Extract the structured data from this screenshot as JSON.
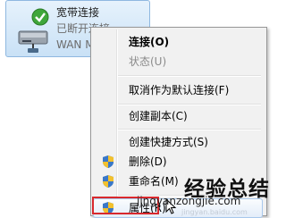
{
  "connection": {
    "name": "宽带连接",
    "status": "已断开连接",
    "type": "WAN M",
    "icon": "network-connection-icon"
  },
  "context_menu": {
    "items": [
      {
        "label": "连接(O)",
        "bold": true,
        "disabled": false,
        "icon": null
      },
      {
        "label": "状态(U)",
        "bold": false,
        "disabled": true,
        "icon": null
      },
      {
        "label": "取消作为默认连接(F)",
        "bold": false,
        "disabled": false,
        "icon": null
      },
      {
        "label": "创建副本(C)",
        "bold": false,
        "disabled": false,
        "icon": null
      },
      {
        "label": "创建快捷方式(S)",
        "bold": false,
        "disabled": false,
        "icon": null
      },
      {
        "label": "删除(D)",
        "bold": false,
        "disabled": false,
        "icon": "uac-shield-icon"
      },
      {
        "label": "重命名(M)",
        "bold": false,
        "disabled": false,
        "icon": "uac-shield-icon"
      },
      {
        "label": "属性(R)",
        "bold": false,
        "disabled": false,
        "icon": "uac-shield-icon",
        "highlighted": true
      }
    ]
  },
  "watermark": {
    "main": "经验总结",
    "url": "jingyanzongjie.com",
    "faint": "jingyan.baidu.com"
  },
  "colors": {
    "highlight_border": "#d8292d",
    "menu_bg": "#f1f1f1",
    "tile_bg": "#c9e1f6"
  }
}
